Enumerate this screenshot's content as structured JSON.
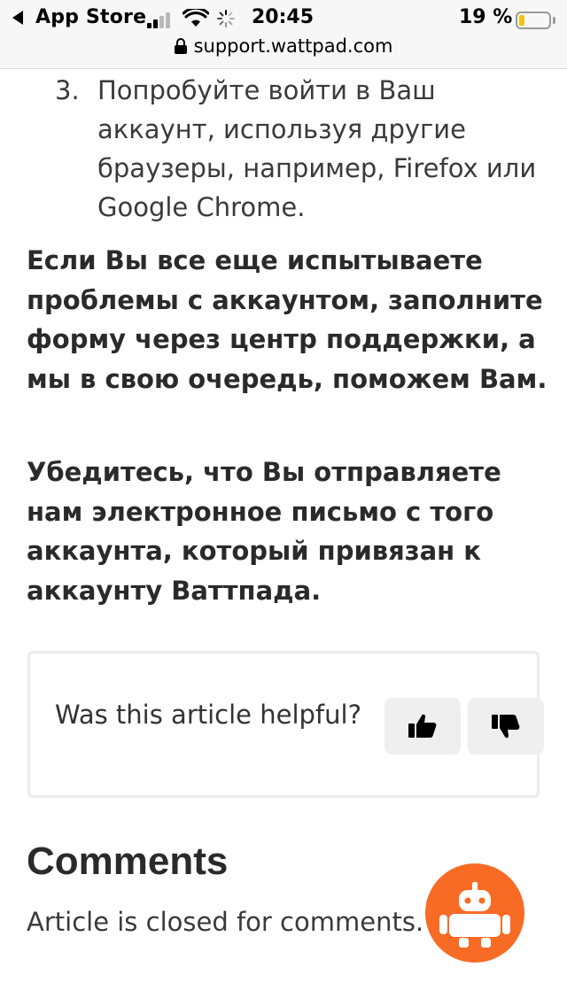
{
  "status_bar": {
    "back_app": "App Store",
    "time": "20:45",
    "battery_percent": "19 %",
    "battery_level": 0.19,
    "colors": {
      "battery_fill": "#f4c20d"
    }
  },
  "url_bar": {
    "icon": "lock-icon",
    "url": "support.wattpad.com"
  },
  "article": {
    "list_item": {
      "number": "3.",
      "text": "Попробуйте войти в Ваш аккаунт, используя другие браузеры, например, Firefox или Google Chrome."
    },
    "paragraphs": [
      "Если Вы все еще испытываете проблемы с аккаунтом, заполните форму через центр поддержки, а мы в свою очередь, поможем Вам.",
      "Убедитесь, что Вы отправляете нам электронное письмо с того аккаунта, который привязан к аккаунту Ваттпада."
    ]
  },
  "helpful": {
    "question": "Was this article helpful?",
    "vote_up_icon": "thumbs-up-icon",
    "vote_down_icon": "thumbs-down-icon"
  },
  "comments": {
    "title": "Comments",
    "closed_text": "Article is closed for comments."
  },
  "fab": {
    "icon": "robot-icon",
    "color": "#f86b25"
  }
}
